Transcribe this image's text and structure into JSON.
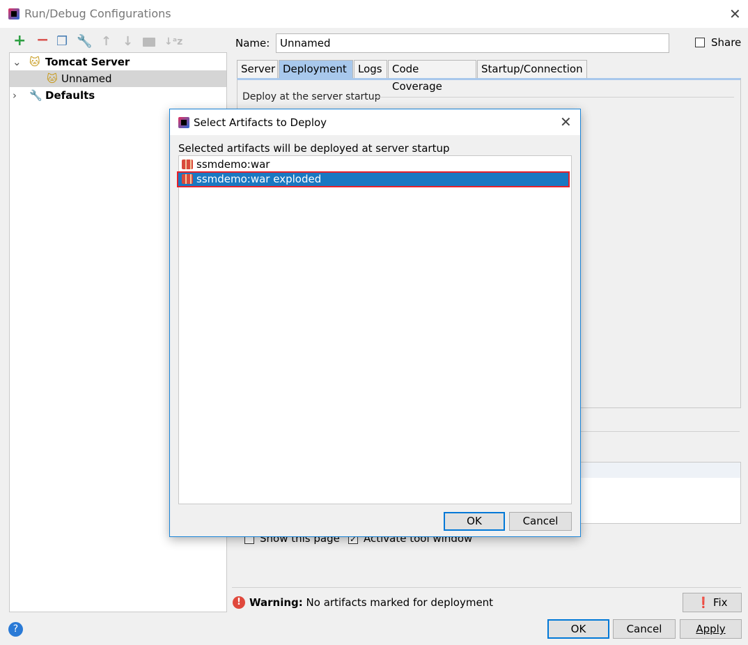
{
  "window": {
    "title": "Run/Debug Configurations",
    "close_icon": "close-icon"
  },
  "toolbar": {
    "icons": [
      "add-icon",
      "remove-icon",
      "copy-icon",
      "edit-defaults-icon",
      "move-up-icon",
      "move-down-icon",
      "folder-icon",
      "sort-icon"
    ]
  },
  "tree": {
    "items": [
      {
        "label": "Tomcat Server",
        "expanded": true
      },
      {
        "label": "Unnamed",
        "selected": true
      },
      {
        "label": "Defaults",
        "expanded": false
      }
    ]
  },
  "name": {
    "label": "Name:",
    "value": "Unnamed"
  },
  "share": {
    "label": "Share",
    "checked": false
  },
  "tabs": [
    {
      "label": "Server"
    },
    {
      "label": "Deployment",
      "active": true
    },
    {
      "label": "Logs"
    },
    {
      "label": "Code Coverage"
    },
    {
      "label": "Startup/Connection"
    }
  ],
  "deployment": {
    "section_label": "Deploy at the server startup"
  },
  "before_launch": {
    "show_page": {
      "label": "Show this page",
      "checked": false
    },
    "activate": {
      "label": "Activate tool window",
      "checked": true
    }
  },
  "warning": {
    "bold": "Warning:",
    "text": "No artifacts marked for deployment",
    "fix_label": "Fix"
  },
  "buttons": {
    "ok": "OK",
    "cancel": "Cancel",
    "apply": "Apply"
  },
  "dialog": {
    "title": "Select Artifacts to Deploy",
    "description": "Selected artifacts will be deployed at server startup",
    "artifacts": [
      {
        "label": "ssmdemo:war",
        "selected": false
      },
      {
        "label": "ssmdemo:war exploded",
        "selected": true
      }
    ],
    "ok": "OK",
    "cancel": "Cancel"
  },
  "colors": {
    "selection": "#1a78c2",
    "highlight_border": "#e8202a",
    "accent": "#0078d7"
  }
}
